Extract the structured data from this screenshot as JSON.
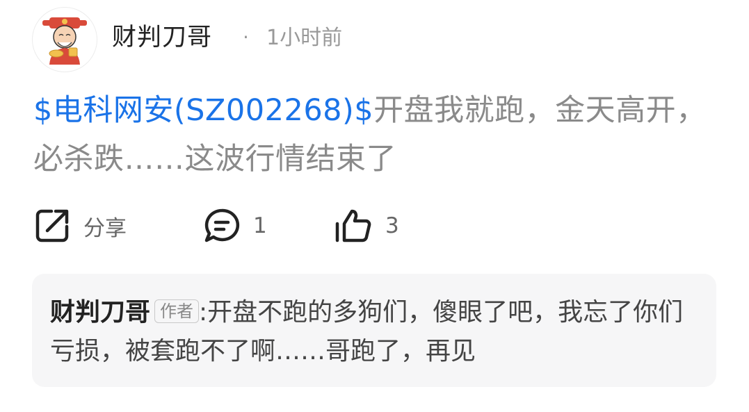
{
  "post": {
    "author": "财判刀哥",
    "separator": "·",
    "time": "1小时前",
    "stock_link": "$电科网安(SZ002268)$",
    "text": "开盘我就跑，金天高开，必杀跌……这波行情结束了"
  },
  "actions": {
    "share_label": "分享",
    "comment_count": "1",
    "like_count": "3"
  },
  "comment": {
    "author": "财判刀哥",
    "author_tag": "作者",
    "colon": ":",
    "text": "开盘不跑的多狗们，傻眼了吧，我忘了你们亏损，被套跑不了啊……哥跑了，再见"
  },
  "colors": {
    "link": "#1a73e8",
    "muted_text": "#8a8a8a",
    "comment_bg": "#f6f6f7"
  },
  "icons": [
    "avatar-caishen",
    "share-icon",
    "comment-icon",
    "like-icon"
  ]
}
